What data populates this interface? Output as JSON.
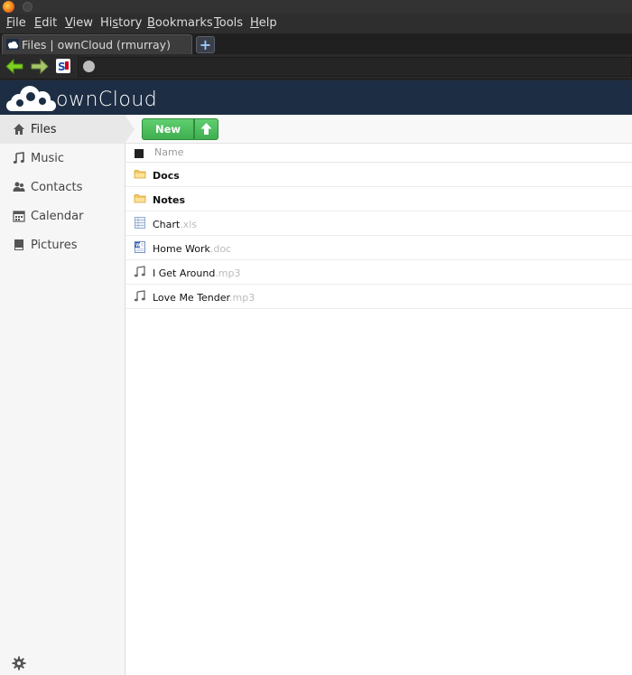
{
  "browser": {
    "menu": [
      {
        "mnemonic": "F",
        "rest": "ile"
      },
      {
        "mnemonic": "E",
        "rest": "dit"
      },
      {
        "mnemonic": "V",
        "rest": "iew"
      },
      {
        "pre": "Hi",
        "mnemonic": "s",
        "rest": "tory"
      },
      {
        "mnemonic": "B",
        "rest": "ookmarks"
      },
      {
        "mnemonic": "T",
        "rest": "ools"
      },
      {
        "mnemonic": "H",
        "rest": "elp"
      }
    ],
    "tab_title": "Files | ownCloud (rmurray)",
    "new_tab_symbol": "+"
  },
  "app": {
    "logo_text": "ownCloud",
    "header_color": "#1d2d44"
  },
  "sidebar": {
    "items": [
      {
        "label": "Files",
        "icon": "home-icon",
        "active": true
      },
      {
        "label": "Music",
        "icon": "music-note-icon"
      },
      {
        "label": "Contacts",
        "icon": "people-icon"
      },
      {
        "label": "Calendar",
        "icon": "calendar-icon"
      },
      {
        "label": "Pictures",
        "icon": "picture-icon"
      }
    ],
    "settings_icon": "gear-icon"
  },
  "controls": {
    "new_label": "New",
    "upload_icon": "upload-arrow-icon",
    "accent": "#4cbf5c"
  },
  "files": {
    "header_name": "Name",
    "rows": [
      {
        "name": "Docs",
        "ext": "",
        "type": "folder"
      },
      {
        "name": "Notes",
        "ext": "",
        "type": "folder"
      },
      {
        "name": "Chart",
        "ext": ".xls",
        "type": "spreadsheet"
      },
      {
        "name": "Home Work",
        "ext": ".doc",
        "type": "document"
      },
      {
        "name": "I Get Around",
        "ext": ".mp3",
        "type": "audio"
      },
      {
        "name": "Love Me Tender",
        "ext": ".mp3",
        "type": "audio"
      }
    ]
  }
}
